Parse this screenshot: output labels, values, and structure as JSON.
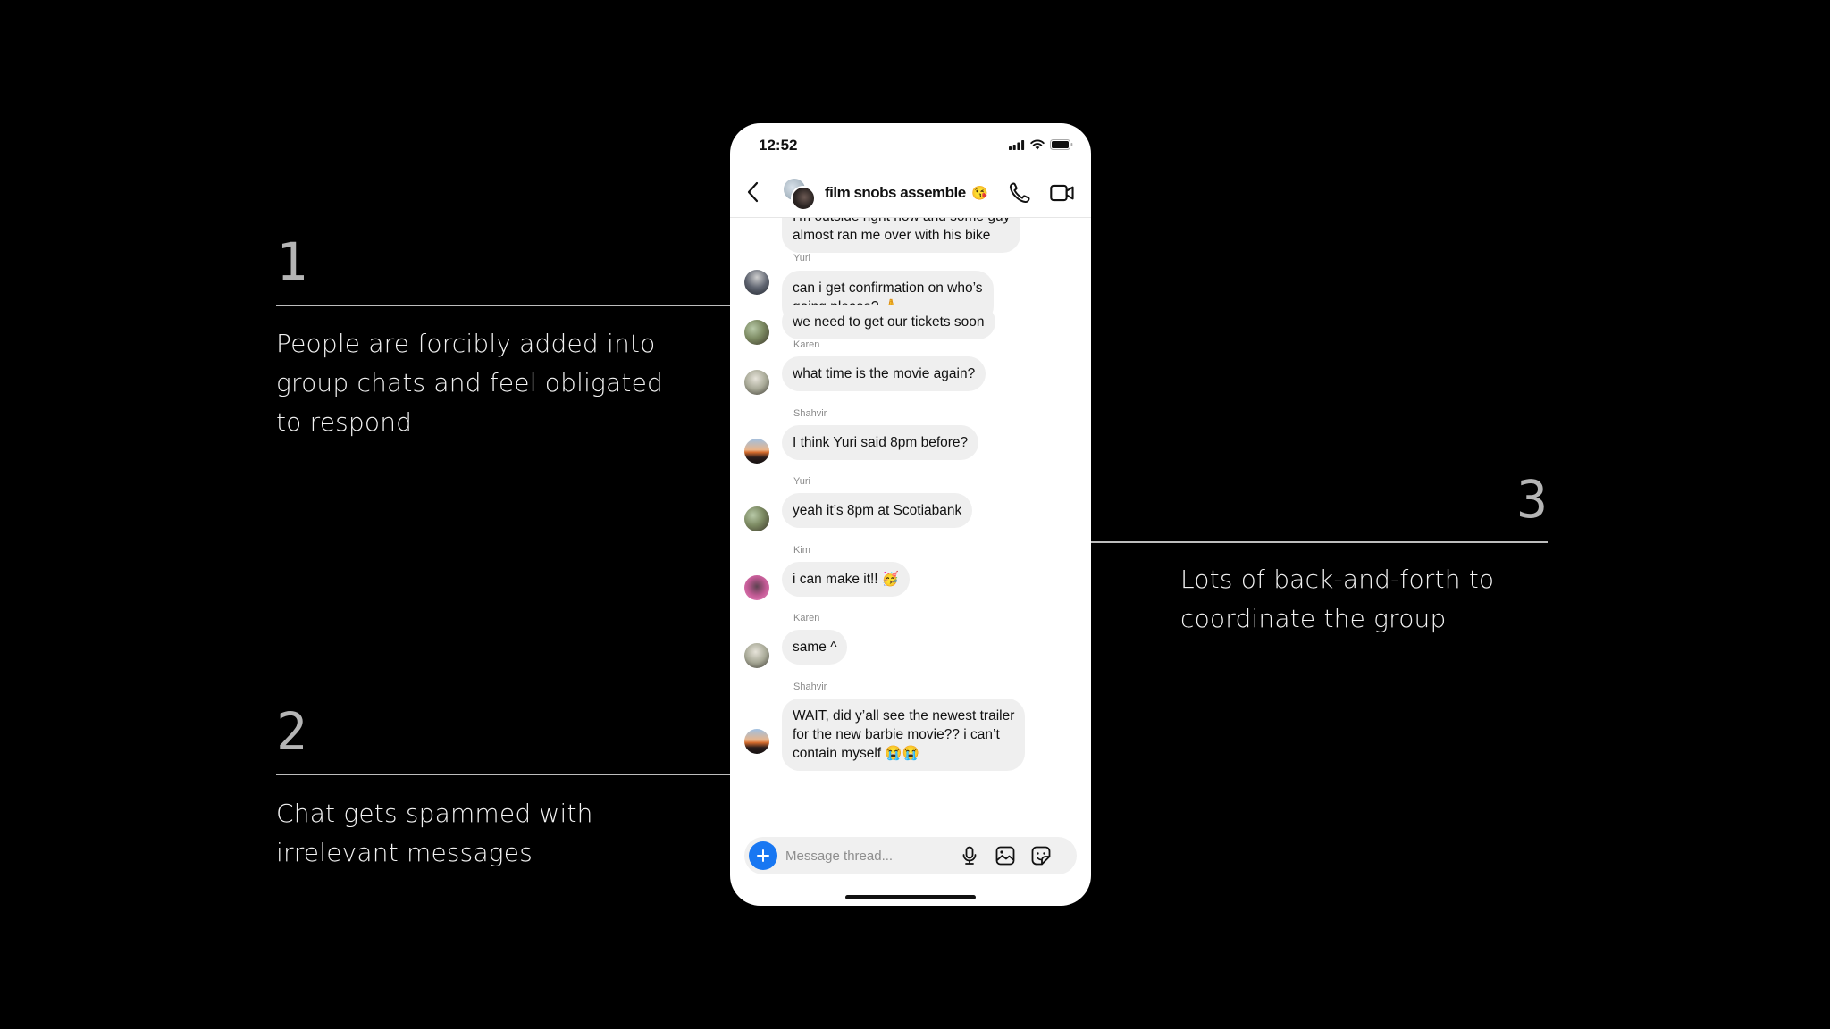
{
  "annotations": [
    {
      "number": "1",
      "text": "People are forcibly added into group chats and feel obligated to respond"
    },
    {
      "number": "2",
      "text": "Chat gets spammed with irrelevant messages"
    },
    {
      "number": "3",
      "text": "Lots of back-and-forth to coordinate the group"
    }
  ],
  "phone": {
    "status_bar": {
      "time": "12:52",
      "icons": [
        "signal-icon",
        "wifi-icon",
        "battery-icon"
      ]
    },
    "header": {
      "title": "film snobs assemble",
      "title_emoji": "😘",
      "icons": [
        "back-icon",
        "group-avatar",
        "phone-icon",
        "video-icon"
      ]
    },
    "messages": [
      {
        "sender": "",
        "avatar": "street",
        "lines": "I'm outside right now and some guy\nalmost ran me over with his bike",
        "partially_hidden": true
      },
      {
        "sender": "Yuri",
        "avatar": "",
        "lines": "can i get confirmation on who’s\ngoing please? 🙏"
      },
      {
        "sender": "",
        "avatar": "plants",
        "lines": "we need to get our tickets soon"
      },
      {
        "sender": "Karen",
        "avatar": "karen",
        "lines": "what time is the movie again?"
      },
      {
        "sender": "Shahvir",
        "avatar": "sunset",
        "lines": "I think Yuri said 8pm before?"
      },
      {
        "sender": "Yuri",
        "avatar": "plants",
        "lines": "yeah it’s 8pm at Scotiabank"
      },
      {
        "sender": "Kim",
        "avatar": "kim",
        "lines": "i can make it!! 🥳"
      },
      {
        "sender": "Karen",
        "avatar": "karen",
        "lines": "same ^"
      },
      {
        "sender": "Shahvir",
        "avatar": "sunset",
        "lines": "WAIT, did y’all see the newest trailer\nfor the new barbie movie?? i can’t\ncontain myself 😭😭"
      }
    ],
    "composer": {
      "placeholder": "Message thread...",
      "value": "",
      "accent_color": "#1877f2",
      "icons": [
        "plus-icon",
        "microphone-icon",
        "image-icon",
        "sticker-icon"
      ]
    }
  }
}
